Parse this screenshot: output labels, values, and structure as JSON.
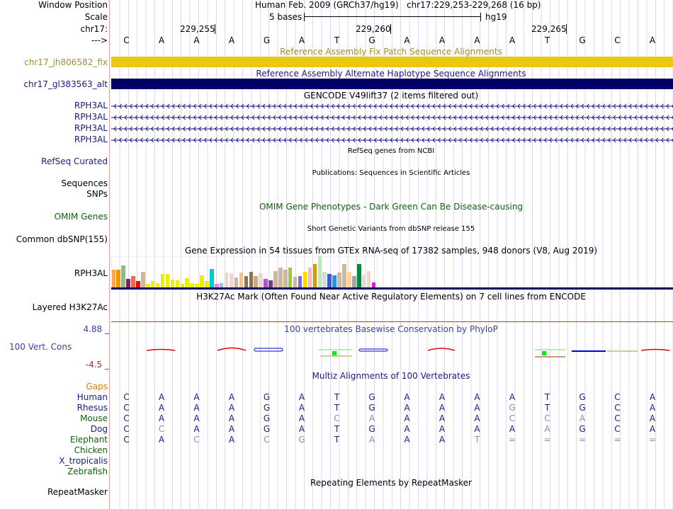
{
  "header": {
    "window_position_label": "Window Position",
    "assembly_title": "Human Feb. 2009 (GRCh37/hg19)",
    "position": "chr17:229,253-229,268 (16 bp)",
    "scale_label": "Scale",
    "scale_bar_text": "5 bases",
    "scale_assembly": "hg19",
    "chrom_label": "chr17:",
    "ticks": [
      "229,255",
      "229,260",
      "229,265"
    ],
    "strand_label": "--->",
    "sequence": "CAAAGATGAAAATGCA"
  },
  "tracks": {
    "fix_patch": {
      "title": "Reference Assembly Fix Patch Sequence Alignments",
      "label": "chr17_jh806582_fix",
      "color": "#e8c810"
    },
    "alt_haplotype": {
      "title": "Reference Assembly Alternate Haplotype Sequence Alignments",
      "label": "chr17_gl383563_alt",
      "color": "#000066"
    },
    "gencode": {
      "title": "GENCODE V49lift37 (2 items filtered out)",
      "items": [
        "RPH3AL",
        "RPH3AL",
        "RPH3AL",
        "RPH3AL"
      ],
      "strand": "minus"
    },
    "refseq": {
      "title": "RefSeq genes from NCBI",
      "label": "RefSeq Curated"
    },
    "publications": {
      "title": "Publications: Sequences in Scientific Articles",
      "label1": "Sequences",
      "label2": "SNPs"
    },
    "omim": {
      "title": "OMIM Gene Phenotypes - Dark Green Can Be Disease-causing",
      "label": "OMIM Genes"
    },
    "dbsnp": {
      "title": "Short Genetic Variants from dbSNP release 155",
      "label": "Common dbSNP(155)"
    },
    "gtex": {
      "title": "Gene Expression in 54 tissues from GTEx RNA-seq of 17382 samples, 948 donors (V8, Aug 2019)",
      "label": "RPH3AL",
      "bars": [
        {
          "c": "#ffa54f",
          "v": 74
        },
        {
          "c": "#ee9a00",
          "v": 74
        },
        {
          "c": "#8fbc8f",
          "v": 92
        },
        {
          "c": "#8b1c62",
          "v": 35
        },
        {
          "c": "#ee6a50",
          "v": 47
        },
        {
          "c": "#ff0000",
          "v": 26
        },
        {
          "c": "#cdb79e",
          "v": 65
        },
        {
          "c": "#eeee00",
          "v": 14
        },
        {
          "c": "#eeee00",
          "v": 26
        },
        {
          "c": "#eeee00",
          "v": 17
        },
        {
          "c": "#eeee00",
          "v": 56
        },
        {
          "c": "#eeee00",
          "v": 56
        },
        {
          "c": "#eeee00",
          "v": 32
        },
        {
          "c": "#eeee00",
          "v": 29
        },
        {
          "c": "#eeee00",
          "v": 14
        },
        {
          "c": "#eeee00",
          "v": 38
        },
        {
          "c": "#eeee00",
          "v": 17
        },
        {
          "c": "#eeee00",
          "v": 14
        },
        {
          "c": "#eeee00",
          "v": 50
        },
        {
          "c": "#eeee00",
          "v": 26
        },
        {
          "c": "#00cdcd",
          "v": 77
        },
        {
          "c": "#ee82ee",
          "v": 14
        },
        {
          "c": "#9ac0cd",
          "v": 17
        },
        {
          "c": "#eed5d2",
          "v": 62
        },
        {
          "c": "#eed5d2",
          "v": 59
        },
        {
          "c": "#cdb79e",
          "v": 41
        },
        {
          "c": "#eec591",
          "v": 62
        },
        {
          "c": "#8b7355",
          "v": 47
        },
        {
          "c": "#8b7355",
          "v": 65
        },
        {
          "c": "#cdaa7d",
          "v": 47
        },
        {
          "c": "#eed5d2",
          "v": 59
        },
        {
          "c": "#b452cd",
          "v": 35
        },
        {
          "c": "#7a378b",
          "v": 29
        },
        {
          "c": "#cdb79e",
          "v": 68
        },
        {
          "c": "#cdb79e",
          "v": 83
        },
        {
          "c": "#cdb79e",
          "v": 74
        },
        {
          "c": "#9acd32",
          "v": 83
        },
        {
          "c": "#cdb79e",
          "v": 44
        },
        {
          "c": "#7b68ee",
          "v": 47
        },
        {
          "c": "#ffd700",
          "v": 65
        },
        {
          "c": "#ffb6c1",
          "v": 83
        },
        {
          "c": "#cd9b1d",
          "v": 98
        },
        {
          "c": "#b4eeb4",
          "v": 132
        },
        {
          "c": "#d9d9d9",
          "v": 65
        },
        {
          "c": "#3a5fcd",
          "v": 56
        },
        {
          "c": "#1e90ff",
          "v": 50
        },
        {
          "c": "#cdb79e",
          "v": 62
        },
        {
          "c": "#cdb79e",
          "v": 98
        },
        {
          "c": "#ffd39b",
          "v": 65
        },
        {
          "c": "#a6a6a6",
          "v": 47
        },
        {
          "c": "#008b45",
          "v": 98
        },
        {
          "c": "#eed5d2",
          "v": 53
        },
        {
          "c": "#eed5d2",
          "v": 68
        },
        {
          "c": "#ff00ff",
          "v": 20
        }
      ]
    },
    "h3k27ac": {
      "title": "H3K27Ac Mark (Often Found Near Active Regulatory Elements) on 7 cell lines from ENCODE",
      "label": "Layered H3K27Ac"
    },
    "phylop": {
      "title": "100 vertebrates Basewise Conservation by PhyloP",
      "label": "100 Vert. Cons",
      "max": "4.88 _",
      "min": "-4.5 _"
    },
    "multiz": {
      "title": "Multiz Alignments of 100 Vertebrates",
      "gaps_label": "Gaps",
      "species": [
        {
          "name": "Human",
          "color": "#1a1a80",
          "bases": "CAAAGATGAAAATGCA",
          "faded": []
        },
        {
          "name": "Rhesus",
          "color": "#1a1a80",
          "bases": "CAAAGATGAAAGTGCA",
          "faded": [
            11
          ]
        },
        {
          "name": "Mouse",
          "color": "#106010",
          "bases": "CAAAGACAAAACCACA",
          "faded": [
            6,
            7,
            11,
            12,
            13
          ]
        },
        {
          "name": "Dog",
          "color": "#1a1a80",
          "bases": "CCAAGATGAAAAAGCA",
          "faded": [
            1,
            12
          ]
        },
        {
          "name": "Elephant",
          "color": "#106010",
          "bases": "CACACGTAAAT=====",
          "faded": [
            2,
            4,
            5,
            7,
            10,
            11,
            12,
            13,
            14,
            15
          ]
        },
        {
          "name": "Chicken",
          "color": "#106010",
          "bases": "",
          "faded": []
        },
        {
          "name": "X_tropicalis",
          "color": "#1a1a80",
          "bases": "",
          "faded": []
        },
        {
          "name": "Zebrafish",
          "color": "#106010",
          "bases": "",
          "faded": []
        }
      ]
    },
    "repeatmasker": {
      "title": "Repeating Elements by RepeatMasker",
      "label": "RepeatMasker"
    }
  }
}
